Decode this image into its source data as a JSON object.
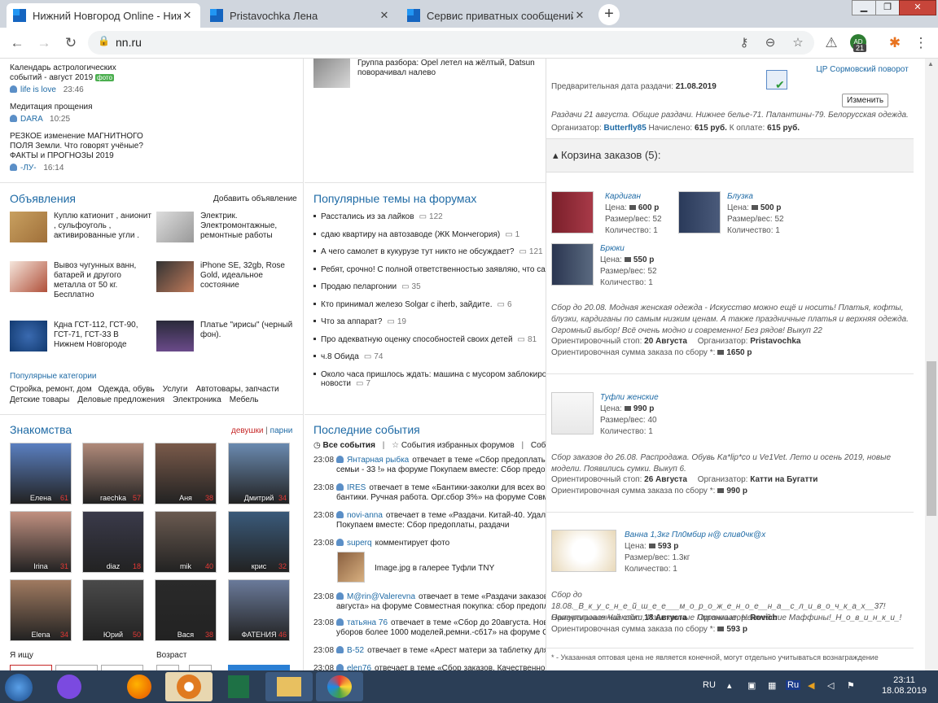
{
  "browser": {
    "tabs": [
      {
        "title": "Нижний Новгород Online - Ниж"
      },
      {
        "title": "Pristavochka Лена"
      },
      {
        "title": "Сервис приватных сообщений"
      }
    ],
    "url": "nn.ru",
    "ext_badge": "21",
    "ext_label": "AD"
  },
  "left": {
    "top_items": [
      {
        "title": "Календарь астрологических событий - август 2019",
        "badge": "фото",
        "user": "life is love",
        "time": "23:46"
      },
      {
        "title": "Медитация прощения",
        "user": "DARA",
        "time": "10:25"
      },
      {
        "title": "РЕЗКОЕ изменение МАГНИТНОГО ПОЛЯ Земли. Что говорят учёные? ФАКТЫ и ПРОГНОЗЫ 2019",
        "user": "-ЛУ-",
        "time": "16:14"
      }
    ],
    "ads_title": "Объявления",
    "ads_add": "Добавить объявление",
    "ads": [
      {
        "text": "Куплю катионит , анионит , сульфоуголь , активированные угли ."
      },
      {
        "text": "Электрик. Электромонтажные, ремонтные работы"
      },
      {
        "text": "Вывоз чугунных ванн, батарей и другого металла от 50 кг. Бесплатно"
      },
      {
        "text": "iPhone SE, 32gb, Rose Gold, идеальное состояние"
      },
      {
        "text": "Кдна ГСТ-112, ГСТ-90, ГСТ-71, ГСТ-33 В Нижнем Новгороде"
      },
      {
        "text": "Платье \"ирисы\" (черный фон)."
      }
    ],
    "categories_title": "Популярные категории",
    "categories": [
      {
        "label": "Стройка, ремонт, дом"
      },
      {
        "label": "Одежда, обувь"
      },
      {
        "label": "Услуги"
      },
      {
        "label": "Автотовары, запчасти"
      },
      {
        "label": "Детские товары"
      },
      {
        "label": "Деловые предложения"
      },
      {
        "label": "Электроника"
      },
      {
        "label": "Мебель"
      }
    ],
    "dating_title": "Знакомства",
    "dating_girls": "девушки",
    "dating_sep": "|",
    "dating_boys": "парни",
    "people": [
      {
        "name": "Елена",
        "age": "61"
      },
      {
        "name": "raechka",
        "age": "57"
      },
      {
        "name": "Аня",
        "age": "38"
      },
      {
        "name": "Дмитрий",
        "age": "34"
      },
      {
        "name": "Irina",
        "age": "31"
      },
      {
        "name": "diaz",
        "age": "18"
      },
      {
        "name": "mik",
        "age": "40"
      },
      {
        "name": "крис",
        "age": "32"
      },
      {
        "name": "Elena",
        "age": "34"
      },
      {
        "name": "Юрий",
        "age": "50"
      },
      {
        "name": "Вася",
        "age": "38"
      },
      {
        "name": "ФАТЕНИЯ",
        "age": "46"
      }
    ],
    "seek_label": "Я ищу",
    "age_label": "Возраст"
  },
  "middle": {
    "top_item": "Группа разбора: Opel летел на жёлтый, Datsun поворачивал налево",
    "forums_title": "Популярные темы на форумах",
    "forums": [
      {
        "title": "Расстались из за лайков",
        "count": "122"
      },
      {
        "title": "сдаю квартиру на автозаводе (ЖК Мончегория)",
        "count": "1"
      },
      {
        "title": "А чего самолет в кукурузе тут никто не обсуждает?",
        "count": "121"
      },
      {
        "title": "Ребят, срочно! С полной ответственностью заявляю, что сайт",
        "count": ""
      },
      {
        "title": "Продаю пеларгонии",
        "count": "35"
      },
      {
        "title": "Кто принимал железо Solgar с iherb, зайдите.",
        "count": "6"
      },
      {
        "title": "Что за аппарат?",
        "count": "19"
      },
      {
        "title": "Про адекватную оценку способностей своих детей",
        "count": "81"
      },
      {
        "title": "ч.8 Обида",
        "count": "74"
      },
      {
        "title": "Около часа пришлось ждать: машина с мусором заблокирова",
        "title2": "новости",
        "count": "7"
      }
    ],
    "events_title": "Последние события",
    "events_tabs": {
      "all": "Все события",
      "fav": "События избранных форумов",
      "more": "Соб"
    },
    "events": [
      {
        "time": "23:08",
        "user": "Янтарная рыбка",
        "line1": "отвечает в теме «Сбор предоплаты,",
        "line2": "семьи - 33 !» на форуме Покупаем вместе: Сбор предопл"
      },
      {
        "time": "23:08",
        "user": "IRES",
        "line1": "отвечает в теме «Бантики-заколки для всех возр",
        "line2": "бантики. Ручная работа. Орг.сбор 3%» на форуме Совме"
      },
      {
        "time": "23:08",
        "user": "novi-anna",
        "line1": "отвечает в теме «Раздачи. Китай-40. Удали",
        "line2": "Покупаем вместе: Сбор предоплаты, раздачи"
      },
      {
        "time": "23:08",
        "user": "superq",
        "line1": "комментирует фото",
        "line2": ""
      },
      {
        "time": "23:08",
        "user": "M@rin@Valerevna",
        "line1": "отвечает в теме «Раздачи заказов.",
        "line2": "августа» на форуме Совместная покупка: сбор предопла"
      },
      {
        "time": "23:08",
        "user": "татьяна 76",
        "line1": "отвечает в теме «Сбор до 20августа. Нови",
        "line2": "уборов более 1000 моделей,ремни.-сб17» на форуме Со"
      },
      {
        "time": "23:08",
        "user": "B-52",
        "line1": "отвечает в теме «Арест матери за таблетку для р",
        "line2": ""
      },
      {
        "time": "23:08",
        "user": "elen76",
        "line1": "отвечает в теме «Сбор заказов. Качественное",
        "line2": ""
      }
    ],
    "photo_caption": "Image.jpg в галерее Туфли TNY"
  },
  "orders": {
    "date_label": "Предварительная дата раздачи:",
    "date": "21.08.2019",
    "location": "ЦР Сормовский поворот",
    "change_btn": "Изменить",
    "top_desc": "Раздачи 21 августа. Общие раздачи. Нижнее белье-71. Палантины-79. Белорусская одежда.",
    "top_meta": {
      "org_label": "Организатор:",
      "org": "Butterfly85",
      "accrued_label": "Начислено:",
      "accrued": "615 руб.",
      "topay_label": "К оплате:",
      "topay": "615 руб."
    },
    "cart_title": "Корзина заказов (5):",
    "price_label": "Цена:",
    "size_label": "Размер/вес:",
    "qty_label": "Количество:",
    "items": [
      {
        "name": "Кардиган",
        "price": "600 р",
        "size": "52",
        "qty": "1"
      },
      {
        "name": "Блузка",
        "price": "500 р",
        "size": "52",
        "qty": "1"
      },
      {
        "name": "Брюки",
        "price": "550 р",
        "size": "52",
        "qty": "1"
      },
      {
        "name": "Туфли женские",
        "price": "990 р",
        "size": "40",
        "qty": "1"
      },
      {
        "name": "Ванна 1,3кг Пл0мбир н@ слив0чк@х",
        "price": "593 р",
        "size": "1.3кг",
        "qty": "1"
      }
    ],
    "groups": [
      {
        "desc": "Сбор до 20.08. Модная женская одежда - Искусство можно ещё и носить! Платья, кофты, блузки, кардиганы по самым низким ценам. А также праздничные платья и верхняя одежда. Огромный выбор! Всё очень модно и современно! Без рядов! Выкуп 22",
        "stop_label": "Ориентировочный стоп:",
        "stop": "20 Августа",
        "org_label": "Организатор:",
        "org": "Pristavochka",
        "sum_label": "Ориентировочная сумма заказа по сбору *:",
        "sum": "1650 р"
      },
      {
        "desc": "Сбор заказов до 26.08. Распродажа. Обувь Ka*lip*co и Ve1Vet. Лето и осень 2019, новые модели. Появились сумки. Выкуп 6.",
        "stop_label": "Ориентировочный стоп:",
        "stop": "26 Августа",
        "org_label": "Организатор:",
        "org": "Катти на Бугатти",
        "sum_label": "Ориентировочная сумма заказа по сбору *:",
        "sum": "990 р"
      },
      {
        "desc": "Сбор до 18.08._В_к_у_с_н_е_й_ш_е_е___м_о_р_о_ж_е_н_о_е__н_а__с_л_и_в_о_ч_к_а_х__37! Натуральные Чизкейки, Изысканные Пирожные, Нежнейшие Маффины!_Н_о_в_и_н_к_и_!",
        "stop_label": "Ориентировочный стоп:",
        "stop": "18 Августа",
        "org_label": "Организатор:",
        "org": "Rovich",
        "sum_label": "Ориентировочная сумма заказа по сбору *:",
        "sum": "593 р"
      }
    ],
    "footnote": "* - Указанная оптовая цена не является конечной, могут отдельно учитываться вознаграждение"
  },
  "taskbar": {
    "lang": "RU",
    "time": "23:11",
    "date": "18.08.2019",
    "kbd": "Ru"
  }
}
